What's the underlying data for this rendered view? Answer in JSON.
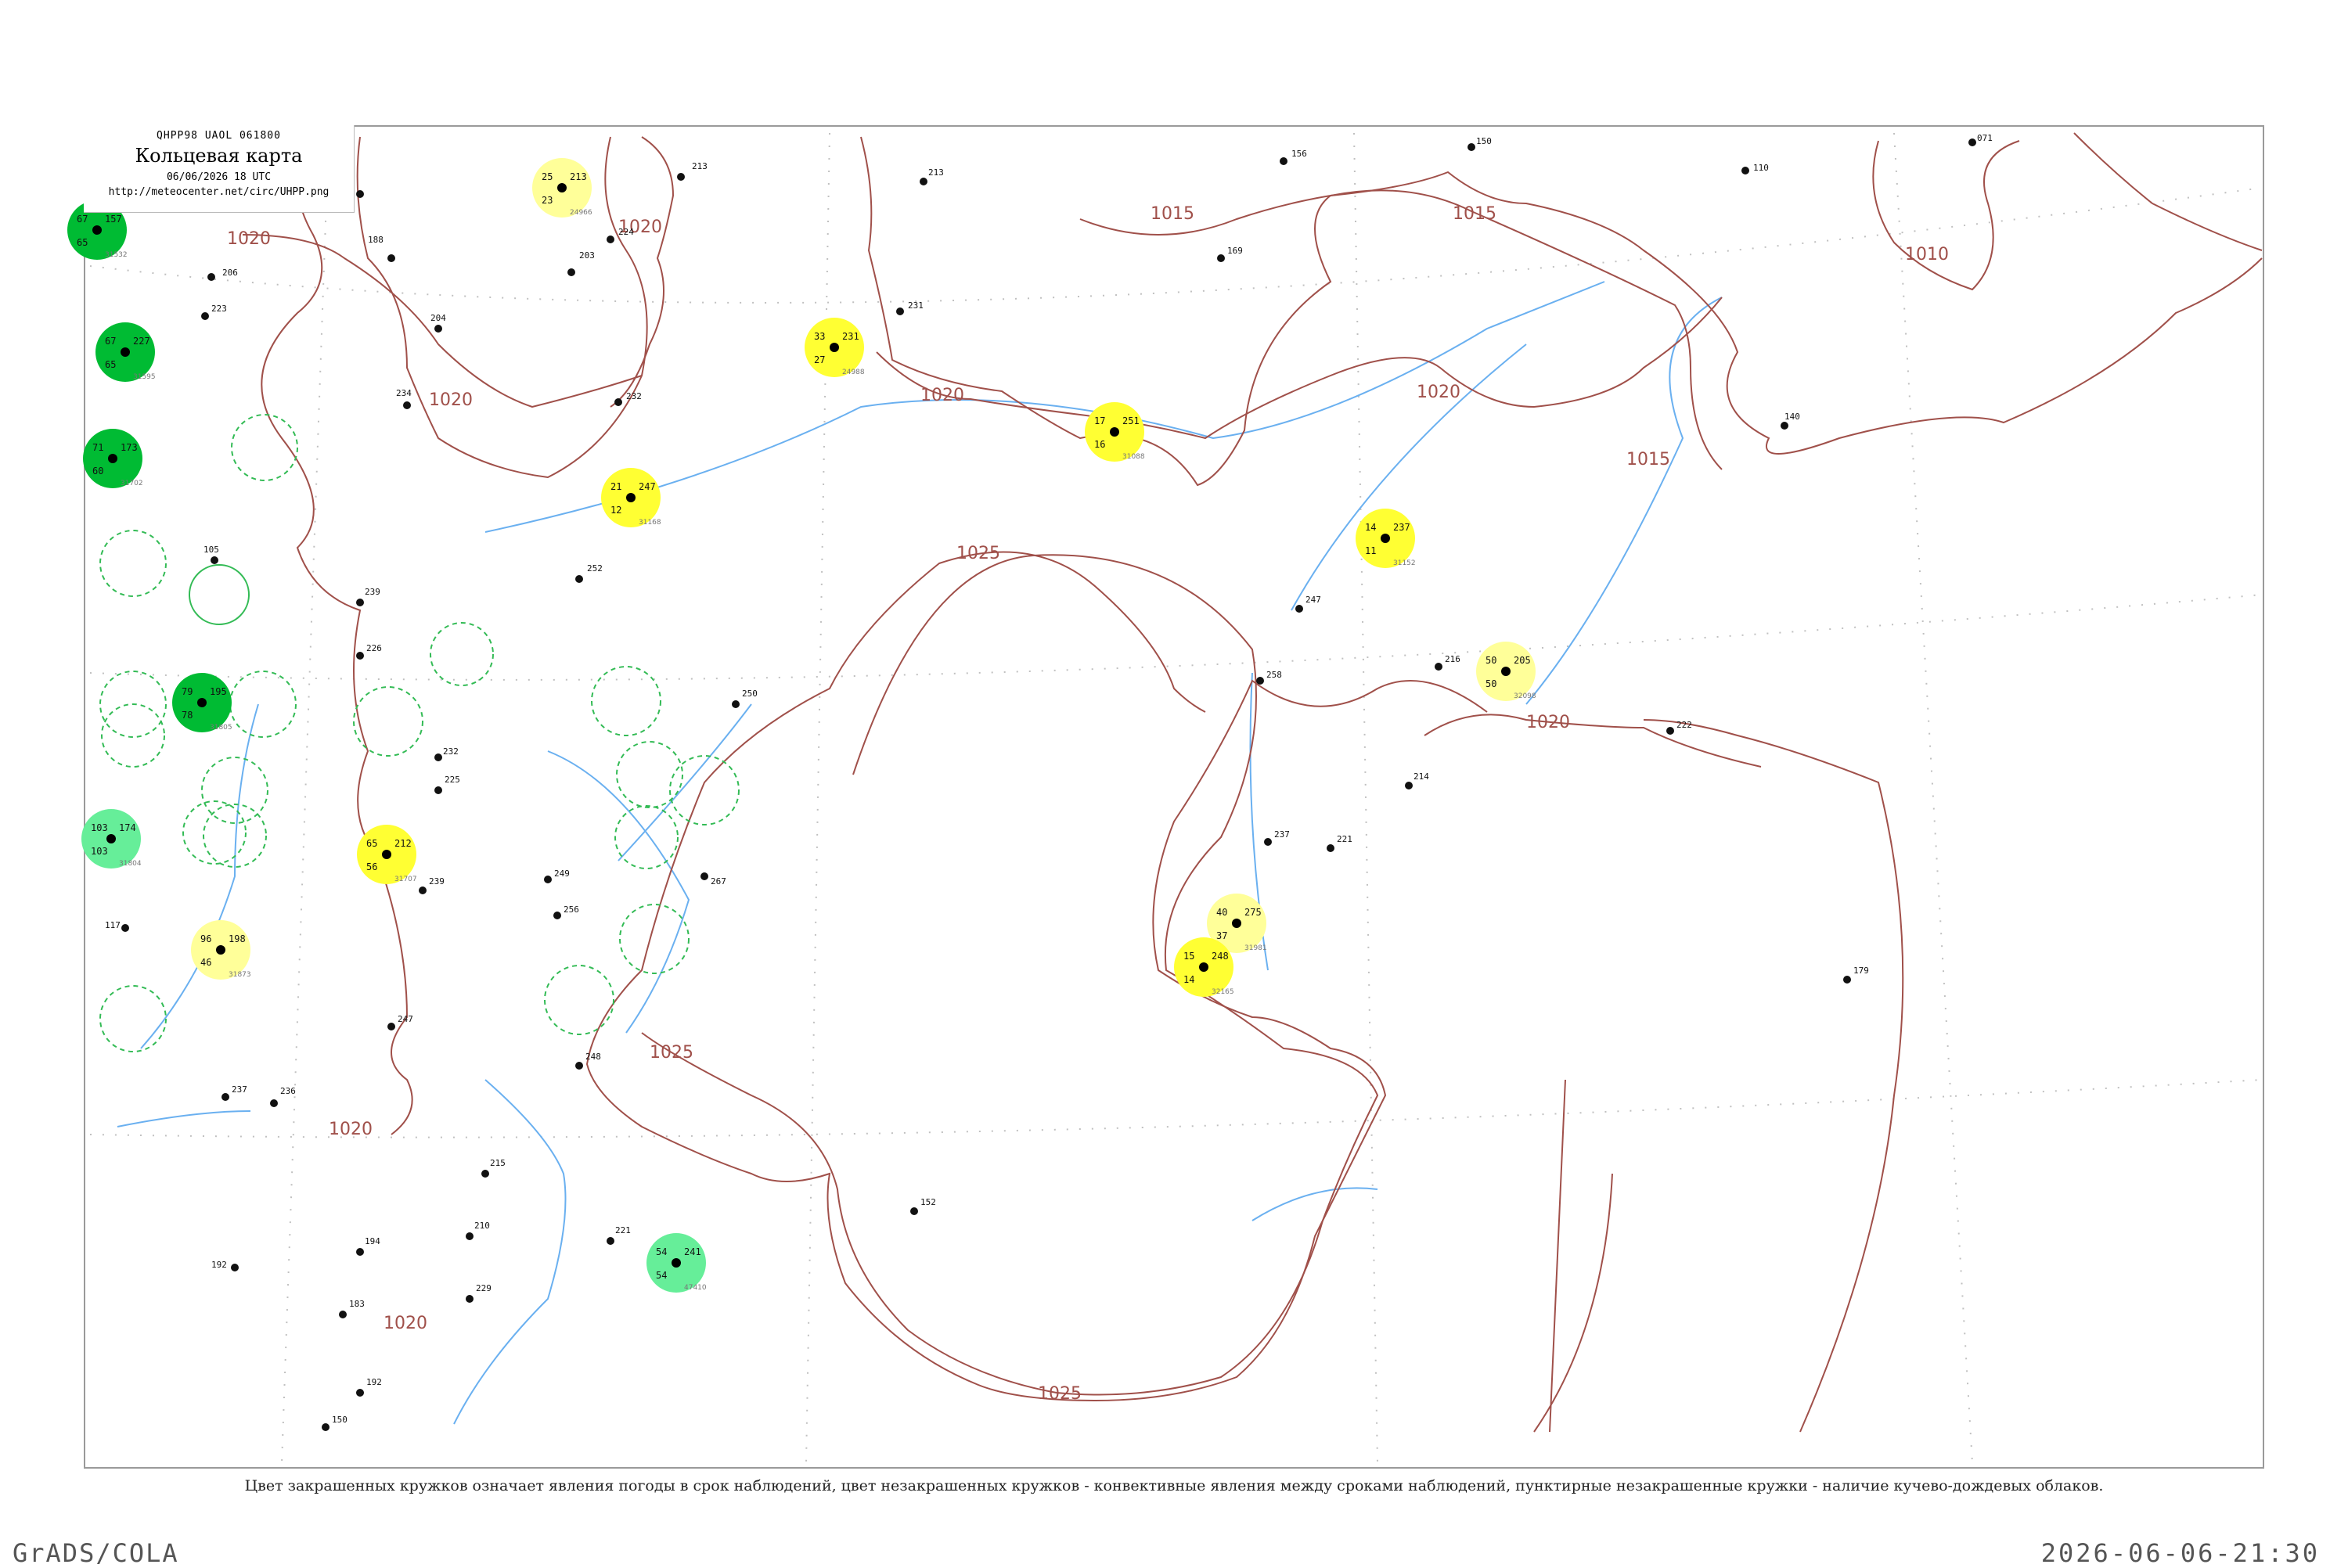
{
  "header": {
    "code": "QHPP98  UAOL  061800",
    "title": "Кольцевая карта",
    "date": "06/06/2026 18 UTC",
    "url": "http://meteocenter.net/circ/UHPP.png"
  },
  "caption": "Цвет закрашенных кружков означает явления погоды в срок наблюдений, цвет незакрашенных кружков - конвективные явления между сроками наблюдений, пунктирные незакрашенные кружки - наличие кучево-дождевых облаков.",
  "footer": {
    "software": "GrADS/COLA",
    "timestamp": "2026-06-06-21:30"
  },
  "colors": {
    "coast": "#a0504a",
    "river": "#6ab0f0",
    "grid": "#c0c0c0",
    "fill_yellow": "#ffff33",
    "fill_light_yellow": "#ffff99",
    "fill_green": "#00bb33",
    "fill_light_green": "#66ee99",
    "ring_green": "#33bb55"
  },
  "isobars": [
    {
      "label": "1020"
    },
    {
      "label": "1020"
    },
    {
      "label": "1020"
    },
    {
      "label": "1020"
    },
    {
      "label": "1020"
    },
    {
      "label": "1020"
    },
    {
      "label": "1020"
    },
    {
      "label": "1020"
    },
    {
      "label": "1015"
    },
    {
      "label": "1015"
    },
    {
      "label": "1015"
    },
    {
      "label": "1010"
    },
    {
      "label": "1025"
    },
    {
      "label": "1025"
    },
    {
      "label": "1025"
    }
  ],
  "stations": [
    {
      "id": "24966",
      "t": "25",
      "td": "23",
      "p": "213",
      "fill": "light_yellow"
    },
    {
      "id": "24988",
      "t": "33",
      "td": "27",
      "p": "231",
      "fill": "yellow"
    },
    {
      "id": "31168",
      "t": "21",
      "td": "12",
      "p": "247",
      "fill": "yellow"
    },
    {
      "id": "31088",
      "t": "17",
      "td": "16",
      "p": "251",
      "fill": "yellow"
    },
    {
      "id": "31152",
      "t": "14",
      "td": "11",
      "p": "237",
      "fill": "yellow"
    },
    {
      "id": "31707",
      "t": "65",
      "td": "56",
      "p": "212",
      "fill": "yellow"
    },
    {
      "id": "32098",
      "t": "50",
      "td": "50",
      "p": "205",
      "fill": "light_yellow"
    },
    {
      "id": "31981",
      "t": "40",
      "td": "37",
      "p": "275",
      "fill": "light_yellow"
    },
    {
      "id": "32165",
      "t": "15",
      "td": "14",
      "p": "248",
      "fill": "yellow"
    },
    {
      "id": "31873",
      "t": "96",
      "td": "46",
      "p": "198",
      "fill": "light_yellow"
    },
    {
      "id": "31532",
      "t": "67",
      "td": "65",
      "p": "157",
      "fill": "green"
    },
    {
      "id": "31595",
      "t": "67",
      "td": "65",
      "p": "227",
      "fill": "green"
    },
    {
      "id": "31702",
      "t": "71",
      "td": "60",
      "p": "173",
      "fill": "green"
    },
    {
      "id": "31805",
      "t": "79",
      "td": "78",
      "p": "195",
      "fill": "green"
    },
    {
      "id": "31804",
      "t": "103",
      "td": "103",
      "p": "174",
      "fill": "light_green"
    },
    {
      "id": "47410",
      "t": "54",
      "td": "54",
      "p": "241",
      "fill": "light_green"
    }
  ]
}
